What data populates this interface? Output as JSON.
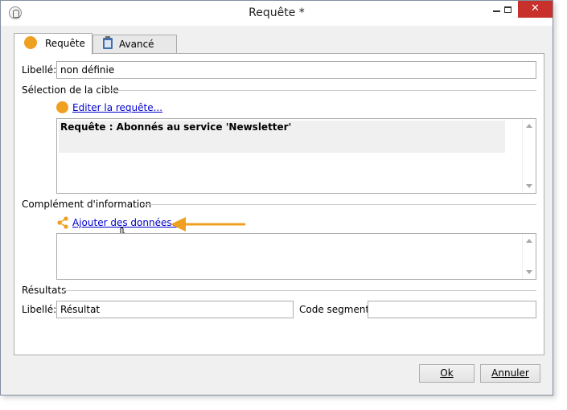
{
  "window": {
    "title": "Requête *",
    "close_glyph": "✕"
  },
  "tabs": [
    {
      "label": "Requête",
      "icon": "orange-circle-icon"
    },
    {
      "label": "Avancé",
      "icon": "clipboard-icon"
    }
  ],
  "form": {
    "libelle_label": "Libellé:",
    "libelle_value": "non définie",
    "target_section": "Sélection de la cible",
    "edit_query_link": "Editer la requête...",
    "query_text": "Requête : Abonnés au service 'Newsletter'",
    "complement_section": "Complément d'information",
    "add_data_link": "Ajouter des données...",
    "results_section": "Résultats",
    "results_libelle_label": "Libellé:",
    "results_libelle_value": "Résultat",
    "segment_code_label": "Code segment:",
    "segment_code_value": ""
  },
  "buttons": {
    "ok_label": "Ok",
    "cancel_label": "Annuler"
  },
  "colors": {
    "accent_orange": "#f0a020",
    "link_blue": "#0000cc",
    "close_red": "#c7302b"
  }
}
